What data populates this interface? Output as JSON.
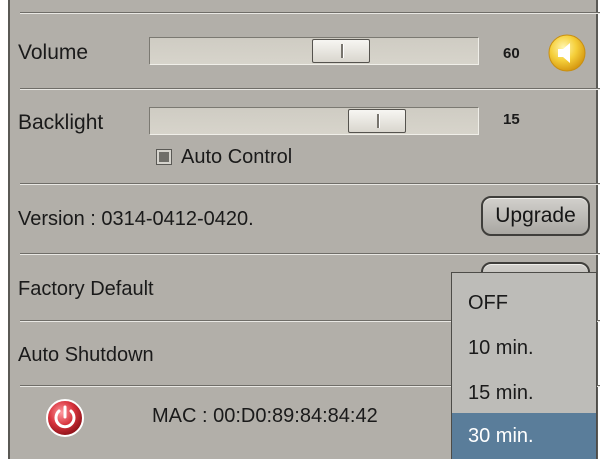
{
  "volume": {
    "label": "Volume",
    "value": "60",
    "level": 60
  },
  "backlight": {
    "label": "Backlight",
    "value": "15",
    "level": 15,
    "auto_control_label": "Auto Control"
  },
  "version": {
    "text": "Version : 0314-0412-0420.",
    "upgrade_label": "Upgrade"
  },
  "factory_default": {
    "label": "Factory Default"
  },
  "auto_shutdown": {
    "label": "Auto Shutdown",
    "options": [
      "OFF",
      "10 min.",
      "15 min.",
      "30 min."
    ],
    "selected": "30 min."
  },
  "footer": {
    "mac_text": "MAC : 00:D0:89:84:84:42"
  },
  "colors": {
    "panel": "#b2afa9",
    "selection": "#5a7d9a",
    "speaker": "#f5cf3a",
    "power": "#d7323c"
  },
  "icons": {
    "speaker": "speaker-icon",
    "power": "power-icon"
  }
}
